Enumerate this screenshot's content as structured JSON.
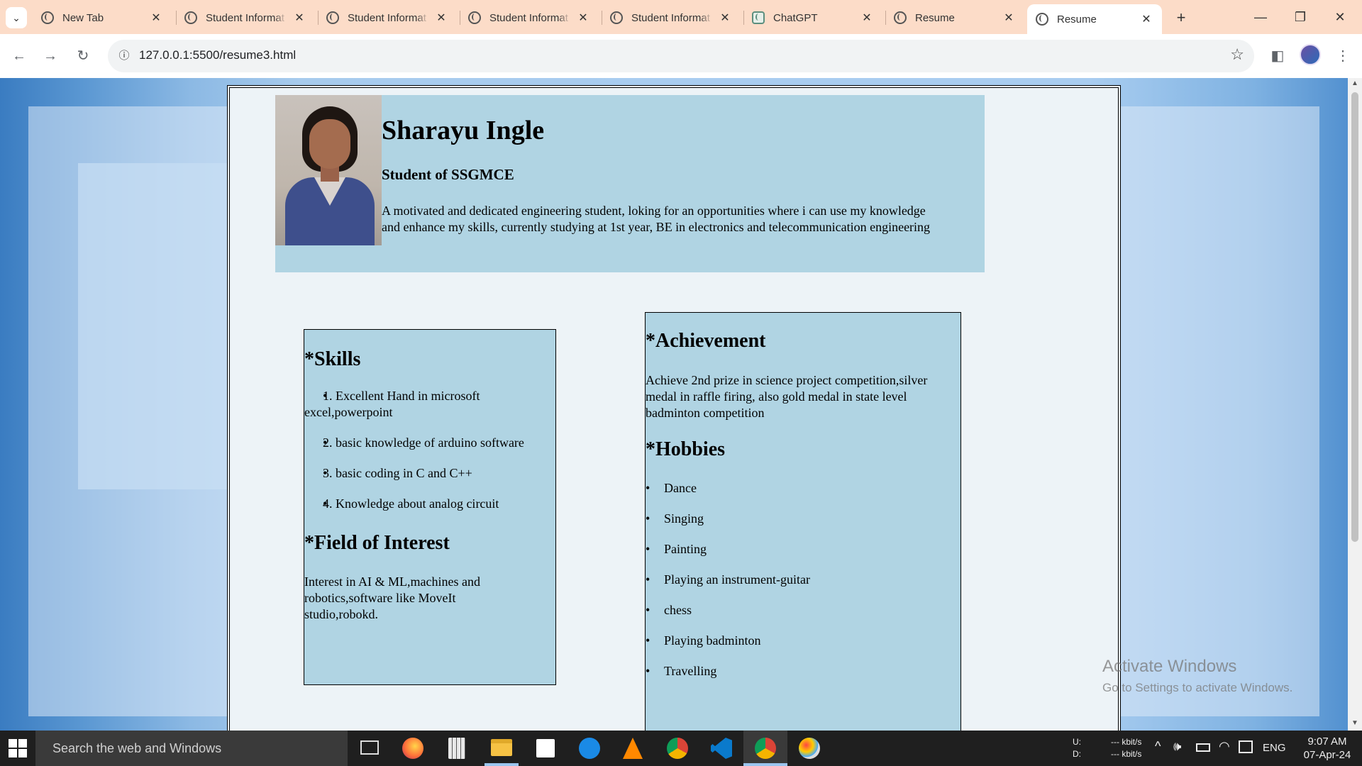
{
  "browser": {
    "tabs": [
      {
        "label": "New Tab",
        "icon": "chrome-icon"
      },
      {
        "label": "Student Informat",
        "icon": "globe-icon"
      },
      {
        "label": "Student Informat",
        "icon": "globe-icon"
      },
      {
        "label": "Student Informat",
        "icon": "globe-icon"
      },
      {
        "label": "Student Informat",
        "icon": "globe-icon"
      },
      {
        "label": "ChatGPT",
        "icon": "chatgpt-icon"
      },
      {
        "label": "Resume",
        "icon": "globe-icon"
      },
      {
        "label": "Resume",
        "icon": "globe-icon",
        "active": true
      }
    ],
    "url": "127.0.0.1:5500/resume3.html",
    "accent": "#fcdcc8"
  },
  "resume": {
    "name": "Sharayu Ingle",
    "subtitle": "Student of SSGMCE",
    "summary": "A motivated and dedicated engineering student, loking for an opportunities where i can use my knowledge and enhance my skills, currently studying at 1st year, BE in electronics and telecommunication engineering",
    "skills_heading": "*Skills",
    "skills": [
      "1. Excellent Hand in microsoft excel,powerpoint",
      "2. basic knowledge of arduino software",
      "3. basic coding in C and C++",
      "4. Knowledge about analog circuit"
    ],
    "interest_heading": "*Field of Interest",
    "interest_text": "Interest in AI & ML,machines and robotics,software like MoveIt studio,robokd.",
    "achievement_heading": "*Achievement",
    "achievement_text": "Achieve 2nd prize in science project competition,silver medal in raffle firing, also gold medal in state level badminton competition",
    "hobbies_heading": "*Hobbies",
    "hobbies": [
      "Dance",
      "Singing",
      "Painting",
      "Playing an instrument-guitar",
      "chess",
      "Playing badminton",
      "Travelling"
    ],
    "box_color": "#b0d4e3"
  },
  "watermark": {
    "line1": "Activate Windows",
    "line2": "Go to Settings to activate Windows."
  },
  "taskbar": {
    "search_placeholder": "Search the web and Windows",
    "net_up_label": "U:",
    "net_down_label": "D:",
    "net_up_value": "--- kbit/s",
    "net_down_value": "--- kbit/s",
    "language": "ENG",
    "time": "9:07 AM",
    "date": "07-Apr-24",
    "apps": [
      "task-view-icon",
      "firefox-icon",
      "calculator-icon",
      "file-explorer-icon",
      "store-icon",
      "edge-icon",
      "vlc-icon",
      "chrome-icon",
      "vscode-icon",
      "chrome-active-icon",
      "paint-icon"
    ]
  }
}
